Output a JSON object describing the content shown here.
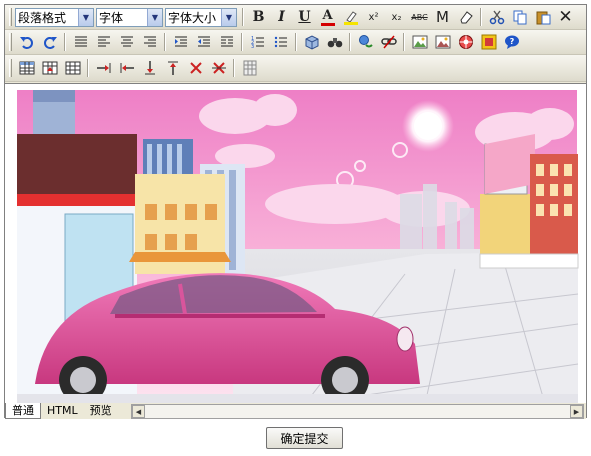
{
  "toolbar1": {
    "paragraph_format": "段落格式",
    "font_family": "字体",
    "font_size": "字体大小",
    "bold": "B",
    "italic": "I",
    "underline": "U",
    "font_color": "A",
    "superscript": "x²",
    "subscript": "x₂",
    "strikethrough": "ABC",
    "m_label": "M",
    "colors": {
      "font_color_bar": "#d40000",
      "highlight_bar": "#f5e400"
    }
  },
  "toolbar2": {
    "icons": [
      "undo-icon",
      "redo-icon",
      "align-justify-icon",
      "align-left-icon",
      "align-center-icon",
      "align-right-icon",
      "indent-icon",
      "outdent-icon",
      "list-indent-icon",
      "ordered-list-icon",
      "unordered-list-icon",
      "insert-3d-icon",
      "find-icon",
      "link-icon",
      "unlink-icon",
      "image-icon",
      "image-properties-icon",
      "media-icon",
      "special-object-icon",
      "help-icon"
    ]
  },
  "toolbar3": {
    "icons": [
      "table-icon",
      "insert-row-above-icon",
      "insert-column-icon",
      "merge-right-icon",
      "merge-left-icon",
      "split-down-icon",
      "split-up-icon",
      "delete-row-icon",
      "delete-column-icon",
      "table-properties-icon"
    ]
  },
  "tabs": [
    "普通",
    "HTML",
    "预览"
  ],
  "active_tab": "普通",
  "submit_label": "确定提交",
  "scene": {
    "sky_top": "#f08bcc",
    "sky_mid": "#f9b6dc",
    "car_color": "#e0509e"
  }
}
